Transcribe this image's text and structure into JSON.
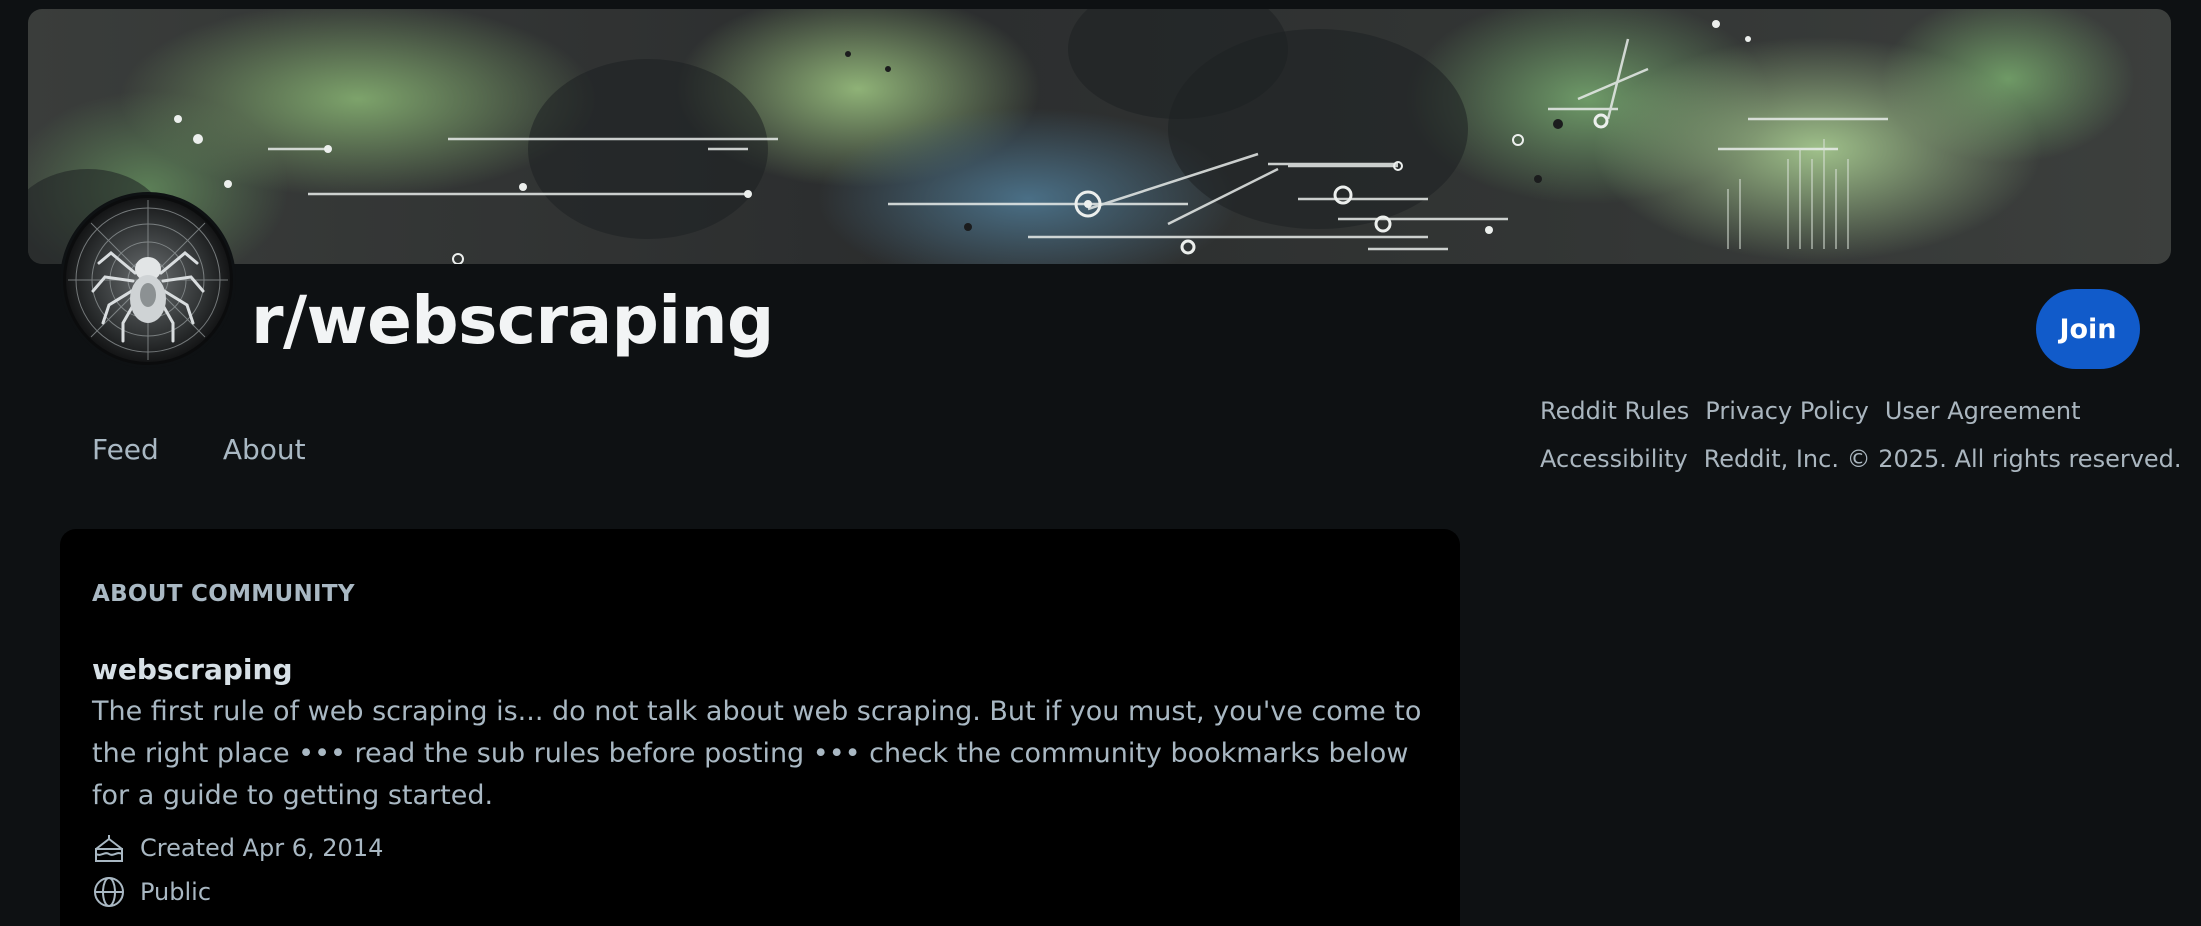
{
  "community": {
    "title": "r/webscraping",
    "join_label": "Join"
  },
  "tabs": [
    {
      "label": "Feed"
    },
    {
      "label": "About"
    }
  ],
  "footer": {
    "links": [
      "Reddit Rules",
      "Privacy Policy",
      "User Agreement",
      "Accessibility"
    ],
    "copyright": "Reddit, Inc. © 2025. All rights reserved."
  },
  "about": {
    "heading": "ABOUT COMMUNITY",
    "name": "webscraping",
    "description": "The first rule of web scraping is... do not talk about web scraping. But if you must, you've come to the right place ••• read the sub rules before posting ••• check the community bookmarks below for a guide to getting started.",
    "created": "Created Apr 6, 2014",
    "visibility": "Public"
  },
  "icons": {
    "avatar": "spider-icon",
    "created": "cake-icon",
    "visibility": "globe-icon"
  },
  "colors": {
    "background": "#0e1113",
    "join_button": "#115bca",
    "card": "#000000"
  }
}
